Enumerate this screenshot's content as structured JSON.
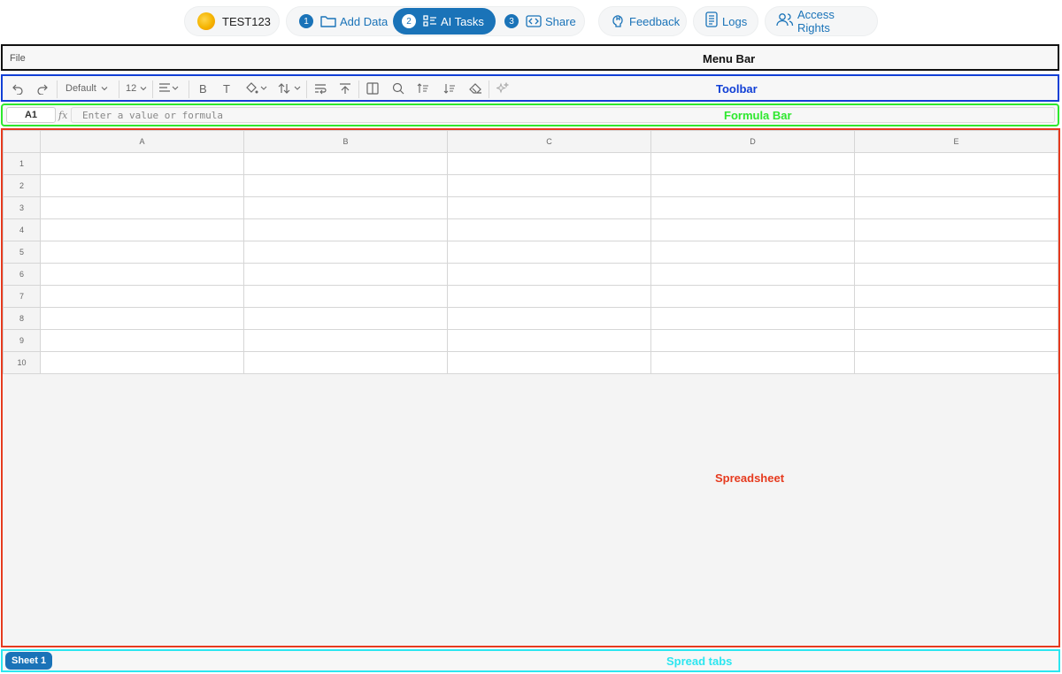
{
  "header": {
    "project_name": "TEST123",
    "steps": [
      {
        "number": "1",
        "label": "Add Data",
        "icon": "folder-icon"
      },
      {
        "number": "2",
        "label": "AI Tasks",
        "icon": "list-icon",
        "active": true
      },
      {
        "number": "3",
        "label": "Share",
        "icon": "code-icon"
      }
    ],
    "nav": {
      "feedback": "Feedback",
      "logs": "Logs",
      "access_rights": "Access Rights"
    },
    "accent_color": "#1a73b8"
  },
  "menubar": {
    "file_label": "File",
    "region_label": "Menu Bar"
  },
  "toolbar": {
    "font_family": "Default",
    "font_size": "12",
    "region_label": "Toolbar"
  },
  "formulabar": {
    "cell_ref": "A1",
    "fx_label": "fx",
    "placeholder": "Enter a value or formula",
    "region_label": "Formula Bar"
  },
  "spreadsheet": {
    "columns": [
      "A",
      "B",
      "C",
      "D",
      "E"
    ],
    "rows": [
      "1",
      "2",
      "3",
      "4",
      "5",
      "6",
      "7",
      "8",
      "9",
      "10"
    ],
    "region_label": "Spreadsheet"
  },
  "tabs": {
    "sheets": [
      "Sheet 1"
    ],
    "region_label": "Spread tabs"
  },
  "region_colors": {
    "menubar": "#111111",
    "toolbar": "#1240d6",
    "formulabar": "#2ee82e",
    "spreadsheet": "#e63a1e",
    "tabs": "#2ce6f0"
  }
}
